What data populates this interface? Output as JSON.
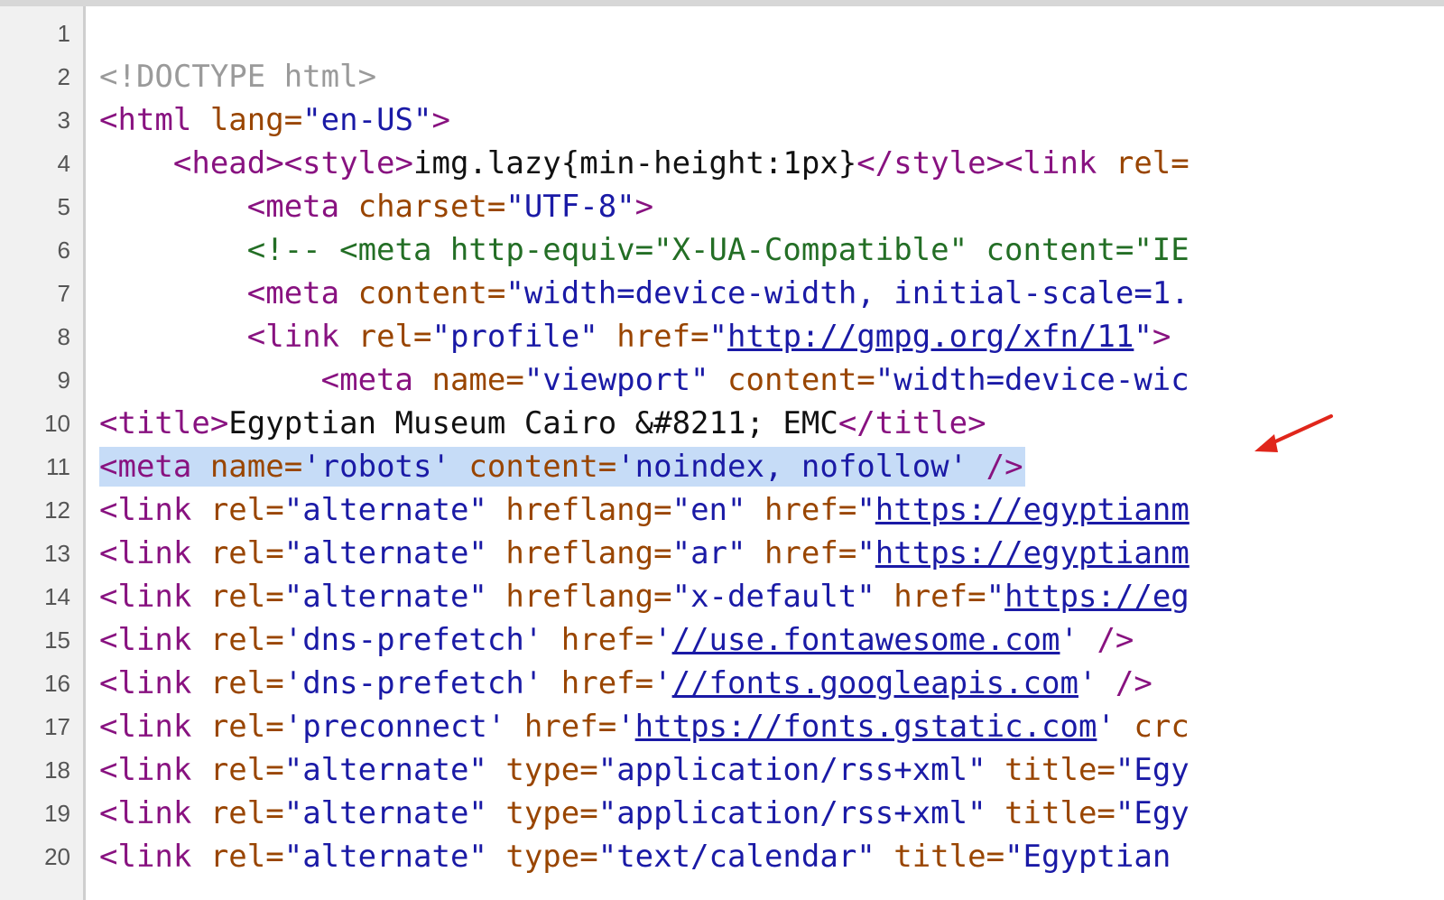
{
  "colors": {
    "tag": "#881280",
    "attribute": "#994500",
    "value": "#1a1aa6",
    "text": "#111111",
    "doctype": "#9a9a9a",
    "comment": "#236e25",
    "highlight": "#c6dcf7",
    "arrow": "#e0261b"
  },
  "annotation_icon": "red-arrow-icon",
  "lines": [
    {
      "num": "1",
      "tokens": []
    },
    {
      "num": "2",
      "tokens": [
        {
          "t": "doctype",
          "s": "<!DOCTYPE html>"
        }
      ]
    },
    {
      "num": "3",
      "tokens": [
        {
          "t": "tag",
          "s": "<html "
        },
        {
          "t": "attr",
          "s": "lang="
        },
        {
          "t": "val",
          "s": "\"en-US\""
        },
        {
          "t": "tag",
          "s": ">"
        }
      ]
    },
    {
      "num": "4",
      "tokens": [
        {
          "t": "txt",
          "s": "    "
        },
        {
          "t": "tag",
          "s": "<head><style>"
        },
        {
          "t": "txt",
          "s": "img.lazy{min-height:1px}"
        },
        {
          "t": "tag",
          "s": "</style><link "
        },
        {
          "t": "attr",
          "s": "rel="
        }
      ]
    },
    {
      "num": "5",
      "tokens": [
        {
          "t": "txt",
          "s": "        "
        },
        {
          "t": "tag",
          "s": "<meta "
        },
        {
          "t": "attr",
          "s": "charset="
        },
        {
          "t": "val",
          "s": "\"UTF-8\""
        },
        {
          "t": "tag",
          "s": ">"
        }
      ]
    },
    {
      "num": "6",
      "tokens": [
        {
          "t": "txt",
          "s": "        "
        },
        {
          "t": "comment",
          "s": "<!-- <meta http-equiv=\"X-UA-Compatible\" content=\"IE"
        }
      ]
    },
    {
      "num": "7",
      "tokens": [
        {
          "t": "txt",
          "s": "        "
        },
        {
          "t": "tag",
          "s": "<meta "
        },
        {
          "t": "attr",
          "s": "content="
        },
        {
          "t": "val",
          "s": "\"width=device-width, initial-scale=1."
        }
      ]
    },
    {
      "num": "8",
      "tokens": [
        {
          "t": "txt",
          "s": "        "
        },
        {
          "t": "tag",
          "s": "<link "
        },
        {
          "t": "attr",
          "s": "rel="
        },
        {
          "t": "val",
          "s": "\"profile\" "
        },
        {
          "t": "attr",
          "s": "href="
        },
        {
          "t": "val",
          "s": "\""
        },
        {
          "t": "link",
          "s": "http://gmpg.org/xfn/11"
        },
        {
          "t": "val",
          "s": "\""
        },
        {
          "t": "tag",
          "s": ">"
        }
      ]
    },
    {
      "num": "9",
      "tokens": [
        {
          "t": "txt",
          "s": "            "
        },
        {
          "t": "tag",
          "s": "<meta "
        },
        {
          "t": "attr",
          "s": "name="
        },
        {
          "t": "val",
          "s": "\"viewport\" "
        },
        {
          "t": "attr",
          "s": "content="
        },
        {
          "t": "val",
          "s": "\"width=device-wic"
        }
      ]
    },
    {
      "num": "10",
      "tokens": [
        {
          "t": "tag",
          "s": "<title>"
        },
        {
          "t": "txt",
          "s": "Egyptian Museum Cairo &#8211; EMC"
        },
        {
          "t": "tag",
          "s": "</title>"
        }
      ]
    },
    {
      "num": "11",
      "highlight": true,
      "tokens": [
        {
          "t": "tag",
          "s": "<meta "
        },
        {
          "t": "attr",
          "s": "name="
        },
        {
          "t": "val",
          "s": "'robots' "
        },
        {
          "t": "attr",
          "s": "content="
        },
        {
          "t": "val",
          "s": "'noindex, nofollow' "
        },
        {
          "t": "tag",
          "s": "/>"
        }
      ]
    },
    {
      "num": "12",
      "tokens": [
        {
          "t": "tag",
          "s": "<link "
        },
        {
          "t": "attr",
          "s": "rel="
        },
        {
          "t": "val",
          "s": "\"alternate\" "
        },
        {
          "t": "attr",
          "s": "hreflang="
        },
        {
          "t": "val",
          "s": "\"en\" "
        },
        {
          "t": "attr",
          "s": "href="
        },
        {
          "t": "val",
          "s": "\""
        },
        {
          "t": "link",
          "s": "https://egyptianm"
        }
      ]
    },
    {
      "num": "13",
      "tokens": [
        {
          "t": "tag",
          "s": "<link "
        },
        {
          "t": "attr",
          "s": "rel="
        },
        {
          "t": "val",
          "s": "\"alternate\" "
        },
        {
          "t": "attr",
          "s": "hreflang="
        },
        {
          "t": "val",
          "s": "\"ar\" "
        },
        {
          "t": "attr",
          "s": "href="
        },
        {
          "t": "val",
          "s": "\""
        },
        {
          "t": "link",
          "s": "https://egyptianm"
        }
      ]
    },
    {
      "num": "14",
      "tokens": [
        {
          "t": "tag",
          "s": "<link "
        },
        {
          "t": "attr",
          "s": "rel="
        },
        {
          "t": "val",
          "s": "\"alternate\" "
        },
        {
          "t": "attr",
          "s": "hreflang="
        },
        {
          "t": "val",
          "s": "\"x-default\" "
        },
        {
          "t": "attr",
          "s": "href="
        },
        {
          "t": "val",
          "s": "\""
        },
        {
          "t": "link",
          "s": "https://eg"
        }
      ]
    },
    {
      "num": "15",
      "tokens": [
        {
          "t": "tag",
          "s": "<link "
        },
        {
          "t": "attr",
          "s": "rel="
        },
        {
          "t": "val",
          "s": "'dns-prefetch' "
        },
        {
          "t": "attr",
          "s": "href="
        },
        {
          "t": "val",
          "s": "'"
        },
        {
          "t": "link",
          "s": "//use.fontawesome.com"
        },
        {
          "t": "val",
          "s": "' "
        },
        {
          "t": "tag",
          "s": "/>"
        }
      ]
    },
    {
      "num": "16",
      "tokens": [
        {
          "t": "tag",
          "s": "<link "
        },
        {
          "t": "attr",
          "s": "rel="
        },
        {
          "t": "val",
          "s": "'dns-prefetch' "
        },
        {
          "t": "attr",
          "s": "href="
        },
        {
          "t": "val",
          "s": "'"
        },
        {
          "t": "link",
          "s": "//fonts.googleapis.com"
        },
        {
          "t": "val",
          "s": "' "
        },
        {
          "t": "tag",
          "s": "/>"
        }
      ]
    },
    {
      "num": "17",
      "tokens": [
        {
          "t": "tag",
          "s": "<link "
        },
        {
          "t": "attr",
          "s": "rel="
        },
        {
          "t": "val",
          "s": "'preconnect' "
        },
        {
          "t": "attr",
          "s": "href="
        },
        {
          "t": "val",
          "s": "'"
        },
        {
          "t": "link",
          "s": "https://fonts.gstatic.com"
        },
        {
          "t": "val",
          "s": "' "
        },
        {
          "t": "attr",
          "s": "crc"
        }
      ]
    },
    {
      "num": "18",
      "tokens": [
        {
          "t": "tag",
          "s": "<link "
        },
        {
          "t": "attr",
          "s": "rel="
        },
        {
          "t": "val",
          "s": "\"alternate\" "
        },
        {
          "t": "attr",
          "s": "type="
        },
        {
          "t": "val",
          "s": "\"application/rss+xml\" "
        },
        {
          "t": "attr",
          "s": "title="
        },
        {
          "t": "val",
          "s": "\"Egy"
        }
      ]
    },
    {
      "num": "19",
      "tokens": [
        {
          "t": "tag",
          "s": "<link "
        },
        {
          "t": "attr",
          "s": "rel="
        },
        {
          "t": "val",
          "s": "\"alternate\" "
        },
        {
          "t": "attr",
          "s": "type="
        },
        {
          "t": "val",
          "s": "\"application/rss+xml\" "
        },
        {
          "t": "attr",
          "s": "title="
        },
        {
          "t": "val",
          "s": "\"Egy"
        }
      ]
    },
    {
      "num": "20",
      "tokens": [
        {
          "t": "tag",
          "s": "<link "
        },
        {
          "t": "attr",
          "s": "rel="
        },
        {
          "t": "val",
          "s": "\"alternate\" "
        },
        {
          "t": "attr",
          "s": "type="
        },
        {
          "t": "val",
          "s": "\"text/calendar\" "
        },
        {
          "t": "attr",
          "s": "title="
        },
        {
          "t": "val",
          "s": "\"Egyptian "
        }
      ]
    }
  ]
}
